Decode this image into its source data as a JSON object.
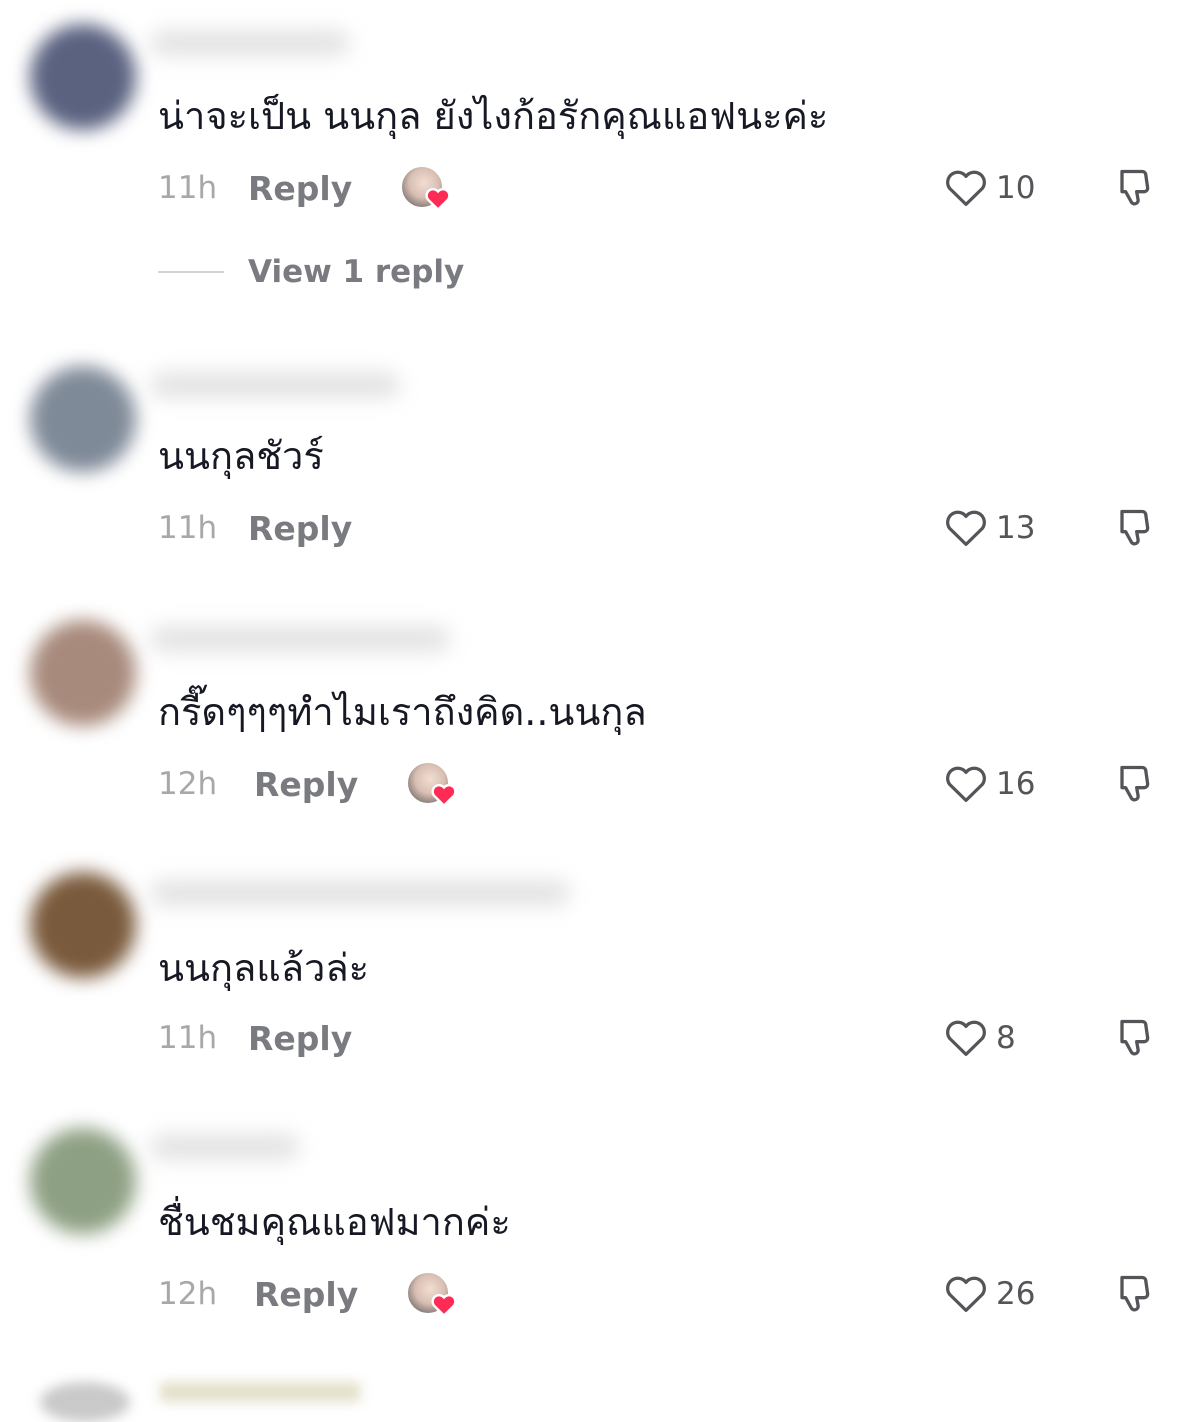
{
  "comments": [
    {
      "text": "น่าจะเป็น นนกุล ยังไงก้อรักคุณแอฟนะค่ะ",
      "time": "11h",
      "reply_label": "Reply",
      "creator_liked": true,
      "likes": "10",
      "avatar_color": "#5a6280",
      "view_replies": "View 1 reply"
    },
    {
      "text": "นนกุลชัวร์",
      "time": "11h",
      "reply_label": "Reply",
      "creator_liked": false,
      "likes": "13",
      "avatar_color": "#7f8a98"
    },
    {
      "text": "กรี๊ดๆๆๆทำไมเราถึงคิด..นนกุล",
      "time": "12h",
      "reply_label": "Reply",
      "creator_liked": true,
      "likes": "16",
      "avatar_color": "#a88a7c"
    },
    {
      "text": "นนกุลแล้วล่ะ",
      "time": "11h",
      "reply_label": "Reply",
      "creator_liked": false,
      "likes": "8",
      "avatar_color": "#7a5a3c"
    },
    {
      "text": "ชื่นชมคุณแอฟมากค่ะ",
      "time": "12h",
      "reply_label": "Reply",
      "creator_liked": true,
      "likes": "26",
      "avatar_color": "#8ea083"
    }
  ],
  "colors": {
    "heart_accent": "#fe2c55",
    "icon_stroke": "#545559",
    "muted_text": "#a8a8ab"
  }
}
